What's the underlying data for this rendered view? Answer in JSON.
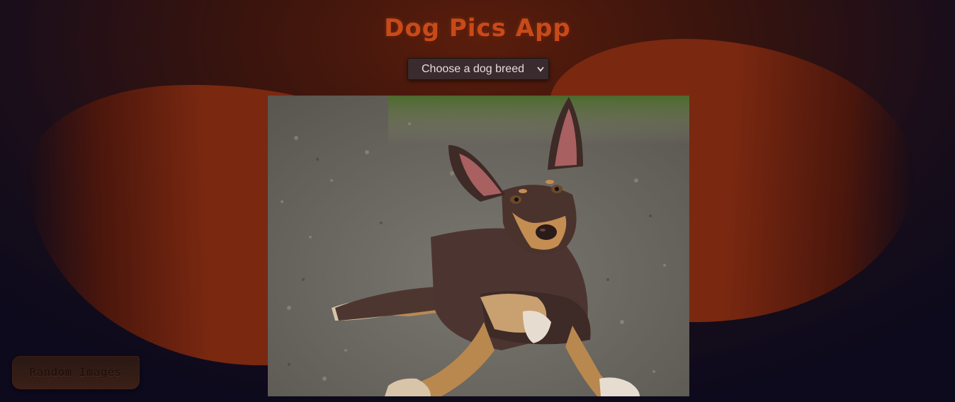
{
  "app": {
    "title": "Dog Pics App"
  },
  "breed_select": {
    "selected_label": "Choose a dog breed"
  },
  "buttons": {
    "random_label": "Random Images"
  },
  "colors": {
    "title": "#c94a18",
    "background_dark": "#0c0a1c",
    "blob": "#7a2810",
    "select_bg": "#3a2b2e"
  },
  "icons": {
    "select_chevron": "chevron-down-icon"
  }
}
